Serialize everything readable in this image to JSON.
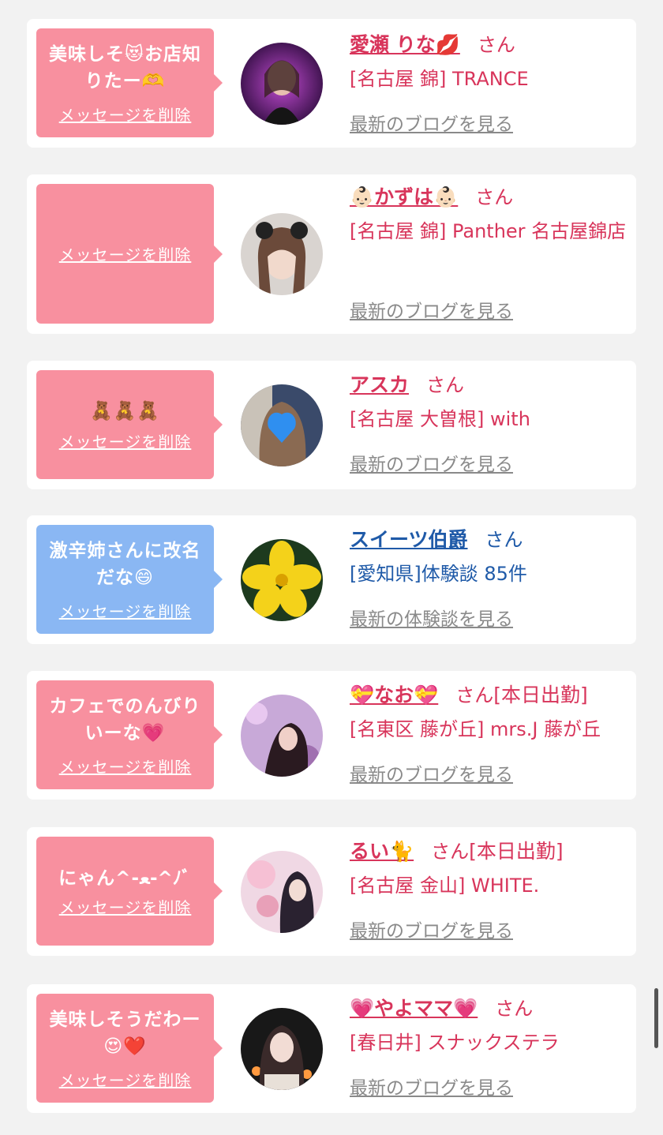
{
  "colors": {
    "page_bg": "#f2f2f2",
    "bubble_pink": "#f8909f",
    "bubble_blue": "#8ab7f3",
    "text_pink": "#d8355b",
    "text_blue": "#1f5aa8",
    "link_gray": "#8a8a8a"
  },
  "items": [
    {
      "message": "美味しそ😻お店知りたー🫶",
      "delete_label": "メッセージを削除",
      "name": "愛瀬 りな💋",
      "honorific": "さん",
      "status": "",
      "shop": "[名古屋 錦] TRANCE",
      "link": "最新のブログを見る"
    },
    {
      "message": "",
      "delete_label": "メッセージを削除",
      "name": "👶🏻かずは👶🏻",
      "honorific": "さん",
      "status": "",
      "shop": "[名古屋 錦] Panther 名古屋錦店",
      "link": "最新のブログを見る"
    },
    {
      "message": "🧸🧸🧸",
      "delete_label": "メッセージを削除",
      "name": "アスカ",
      "honorific": "さん",
      "status": "",
      "shop": "[名古屋 大曽根] with",
      "link": "最新のブログを見る"
    },
    {
      "message": "激辛姉さんに改名だな😄",
      "delete_label": "メッセージを削除",
      "name": "スイーツ伯爵",
      "honorific": "さん",
      "status": "",
      "shop": "[愛知県]体験談 85件",
      "link": "最新の体験談を見る"
    },
    {
      "message": "カフェでのんびりいーな💗",
      "delete_label": "メッセージを削除",
      "name": "💝なお💝",
      "honorific": "さん",
      "status": "[本日出勤]",
      "shop": "[名東区 藤が丘] mrs.J 藤が丘",
      "link": "最新のブログを見る"
    },
    {
      "message": "にゃん^-ﻌ-^ﾉﾞ",
      "delete_label": "メッセージを削除",
      "name": "るい🐈",
      "honorific": "さん",
      "status": "[本日出勤]",
      "shop": "[名古屋 金山] WHITE.",
      "link": "最新のブログを見る"
    },
    {
      "message": "美味しそうだわー😍❤️",
      "delete_label": "メッセージを削除",
      "name": "💗やよママ💗",
      "honorific": "さん",
      "status": "",
      "shop": "[春日井] スナックステラ",
      "link": "最新のブログを見る"
    }
  ]
}
